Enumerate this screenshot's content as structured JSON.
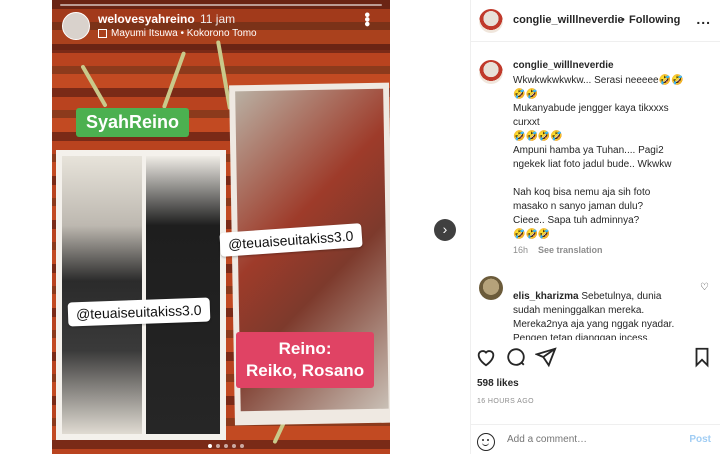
{
  "story": {
    "username": "welovesyahreino",
    "time": "11 jam",
    "music": "Mayumi Itsuwa • Kokorono Tomo",
    "label_green": "SyahReino",
    "watermark_1": "@teuaiseuitakiss3.0",
    "watermark_2": "@teuaiseuitakiss3.0",
    "label_pink_line1": "Reino:",
    "label_pink_line2": "Reiko, Rosano"
  },
  "nav": {
    "next_icon": "›"
  },
  "header": {
    "username": "conglie_willlneverdie",
    "separator": "•",
    "follow_label": "Following",
    "more_label": "..."
  },
  "caption": {
    "username": "conglie_willlneverdie",
    "text": "Wkwkwkwkwkw... Serasi neeeee🤣🤣\n🤣🤣\nMukanyabude jengger kaya tikxxxs\ncurxxt\n🤣🤣🤣🤣\nAmpuni hamba ya Tuhan.... Pagi2\nngekek liat foto jadul bude.. Wkwkw\n\nNah koq bisa nemu aja sih foto\nmasako n sanyo jaman dulu?\nCieee.. Sapa tuh adminnya?\n🤣🤣🤣",
    "time": "16h",
    "translation_label": "See translation"
  },
  "comment": {
    "username": "elis_kharizma",
    "text": "Sebetulnya, dunia\nsudah meninggalkan mereka.\nMereka2nya aja yang nggak nyadar.\nPengen tetap dianggap incess."
  },
  "likes": "598 likes",
  "time_ago": "16 HOURS AGO",
  "add_comment": {
    "placeholder": "Add a comment…",
    "post_label": "Post"
  },
  "colors": {
    "post_disabled": "#a0cdf4",
    "green_label": "#4cb050",
    "pink_label": "#e04364"
  }
}
